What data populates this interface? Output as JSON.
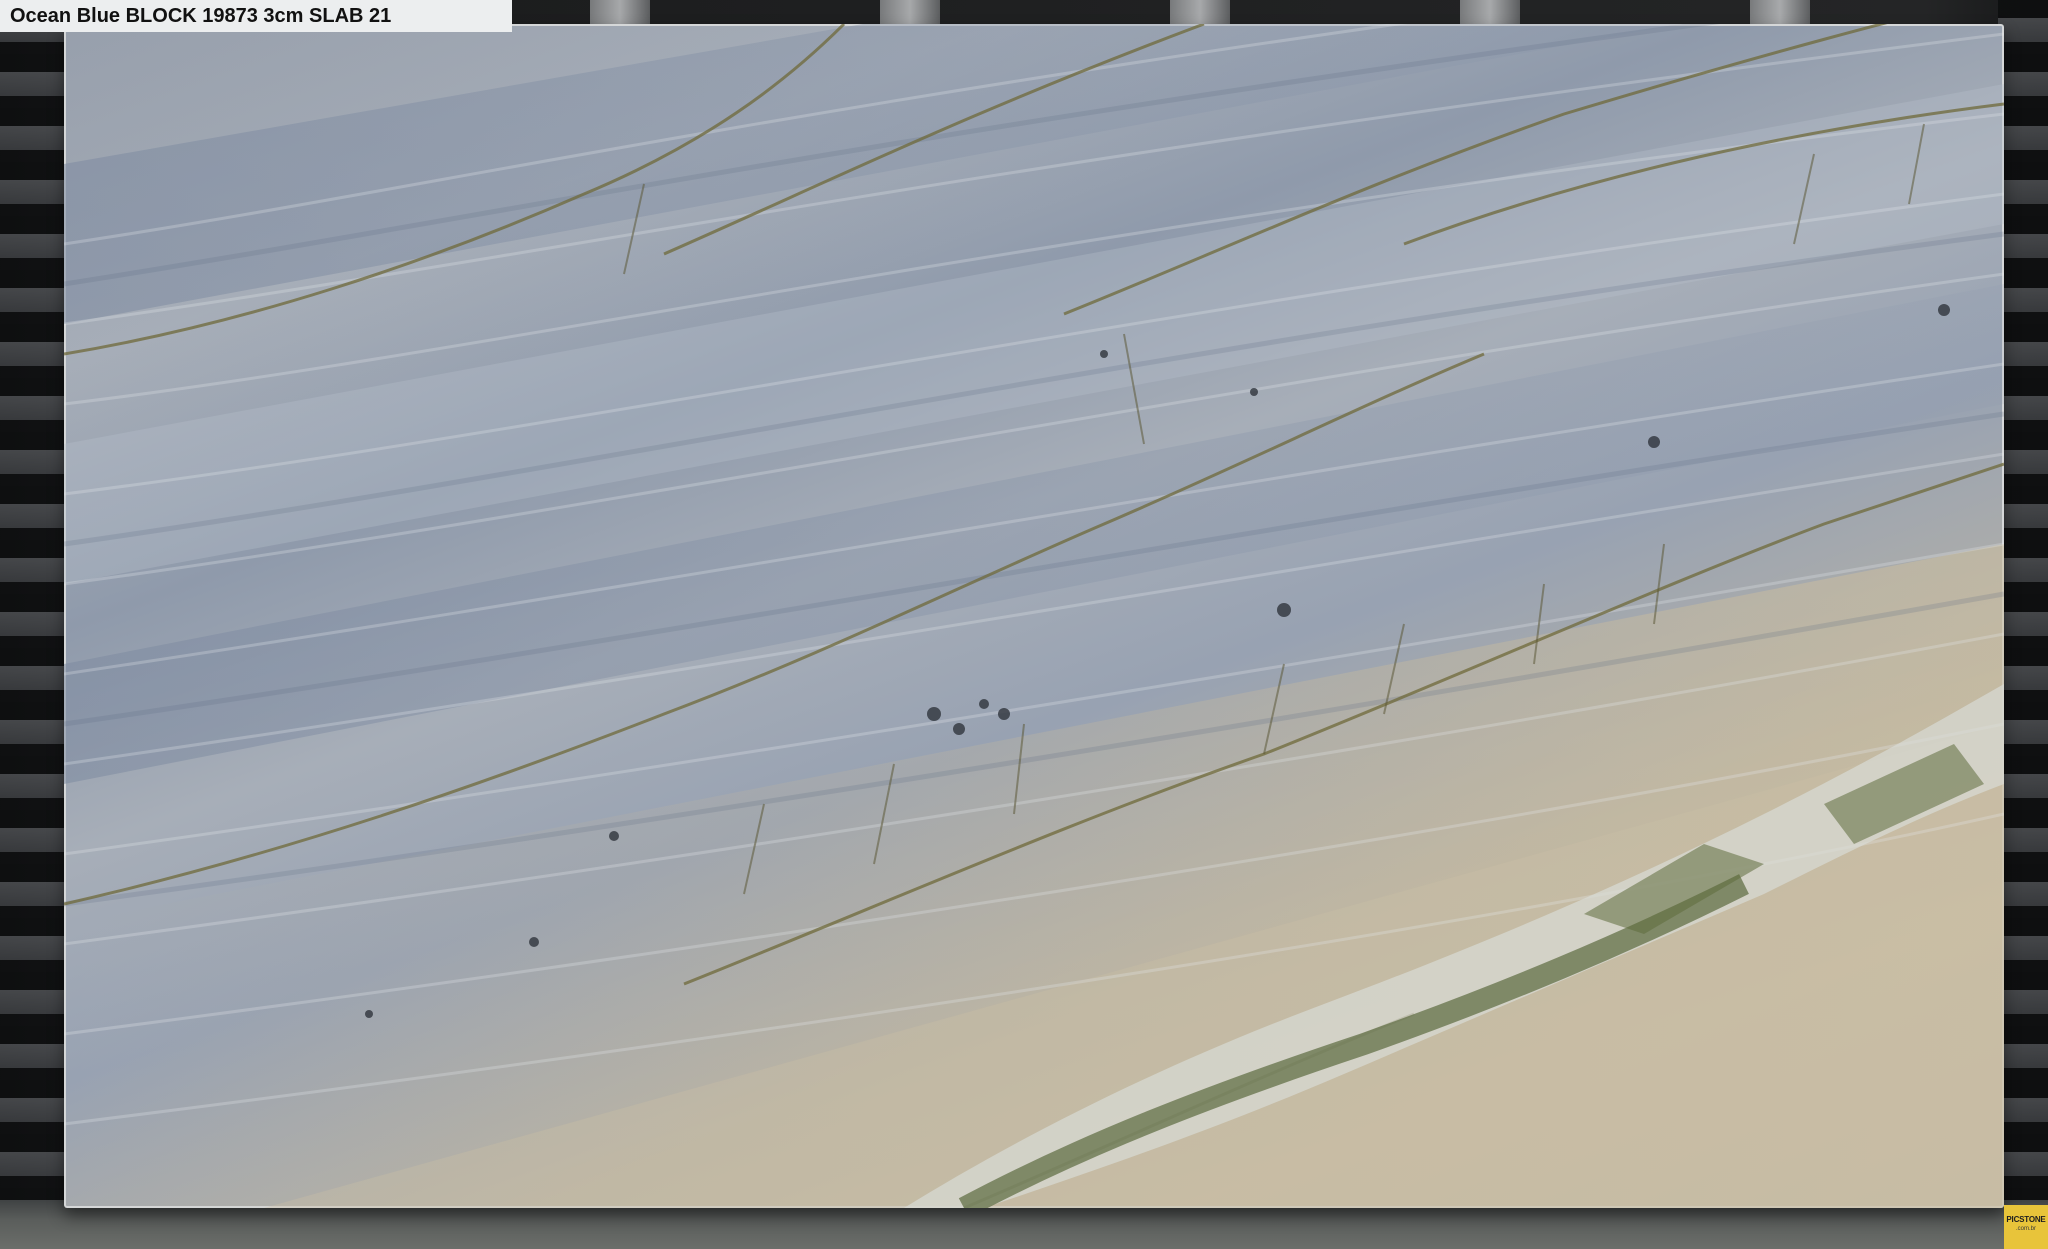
{
  "caption": {
    "text": "Ocean Blue BLOCK 19873 3cm SLAB 21"
  },
  "watermark": {
    "brand": "PICSTONE",
    "domain": ".com.br"
  },
  "colors": {
    "background": "#1b1c1d",
    "slab_blue_gray": "#98a2b2",
    "slab_beige": "#c3baa7",
    "vein_olive": "#6f6a3a",
    "caption_bg": "#eceeef",
    "watermark_bg": "#e8c43a"
  }
}
